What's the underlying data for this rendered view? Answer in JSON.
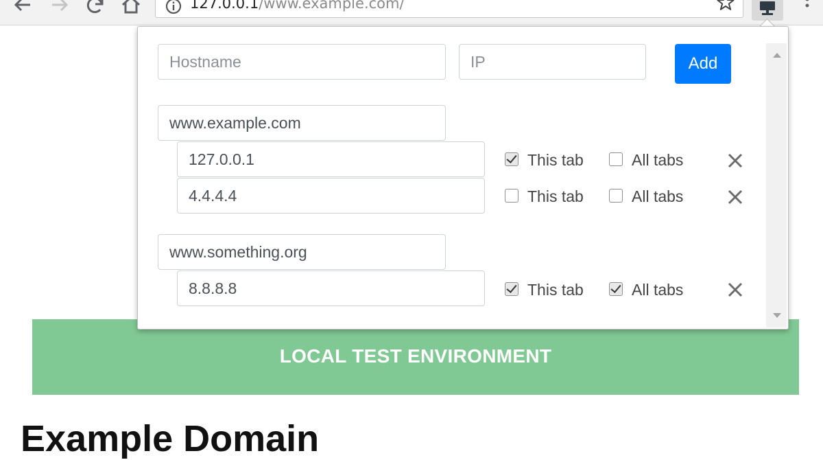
{
  "browser": {
    "url_host": "127.0.0.1",
    "url_path": "/www.example.com/"
  },
  "popup": {
    "hostname_placeholder": "Hostname",
    "ip_placeholder": "IP",
    "add_label": "Add",
    "checkbox_this_tab_label": "This tab",
    "checkbox_all_tabs_label": "All tabs",
    "groups": [
      {
        "hostname": "www.example.com",
        "entries": [
          {
            "ip": "127.0.0.1",
            "this_tab": true,
            "all_tabs": false
          },
          {
            "ip": "4.4.4.4",
            "this_tab": false,
            "all_tabs": false
          }
        ]
      },
      {
        "hostname": "www.something.org",
        "entries": [
          {
            "ip": "8.8.8.8",
            "this_tab": true,
            "all_tabs": true
          }
        ]
      }
    ]
  },
  "page": {
    "banner": "LOCAL TEST ENVIRONMENT",
    "heading": "Example Domain"
  },
  "colors": {
    "accent": "#007bff",
    "banner": "#80c994"
  }
}
